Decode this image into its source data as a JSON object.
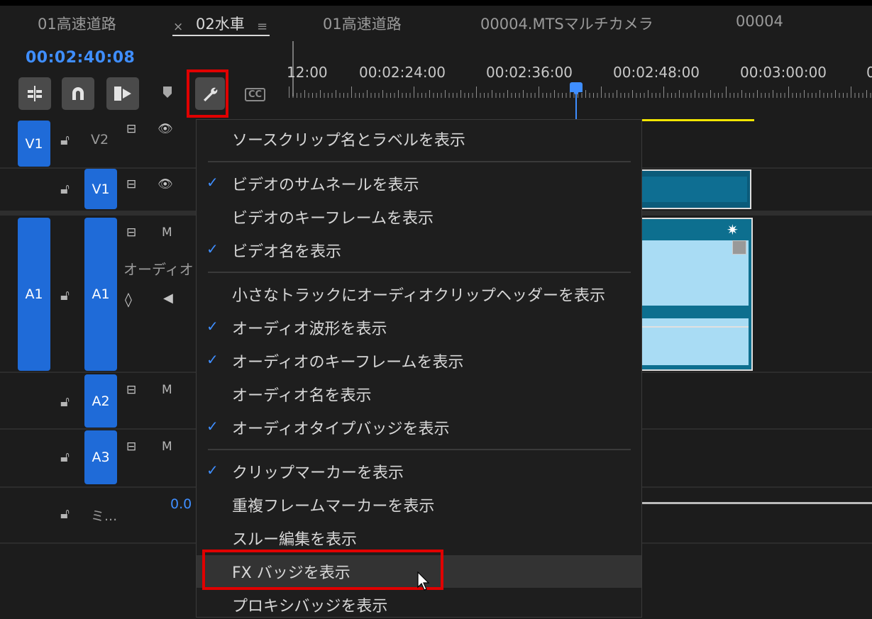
{
  "tabs": [
    {
      "label": "01高速道路",
      "active": false
    },
    {
      "label": "02水車",
      "active": true
    },
    {
      "label": "01高速道路",
      "active": false
    },
    {
      "label": "00004.MTSマルチカメラ",
      "active": false
    },
    {
      "label": "00004",
      "active": false
    }
  ],
  "tab_close": "×",
  "tab_menu": "≡",
  "timecode": "00:02:40:08",
  "ruler_labels": [
    "12:00",
    "00:02:24:00",
    "00:02:36:00",
    "00:02:48:00",
    "00:03:00:00",
    "0"
  ],
  "toolbar": {
    "cc_label": "CC"
  },
  "tracks": {
    "v2_target": "V1",
    "v2_label": "V2",
    "v1_label": "V1",
    "a1_target": "A1",
    "a1_label": "A1",
    "a1_mute": "M",
    "a1_name": "オーディオ",
    "a2_label": "A2",
    "a2_mute": "M",
    "a3_label": "A3",
    "a3_mute": "M",
    "mix_label": "ミ...",
    "mix_value": "0.0"
  },
  "menu": {
    "items": [
      {
        "label": "ソースクリップ名とラベルを表示",
        "checked": false
      },
      {
        "label": "ビデオのサムネールを表示",
        "checked": true
      },
      {
        "label": "ビデオのキーフレームを表示",
        "checked": false
      },
      {
        "label": "ビデオ名を表示",
        "checked": true
      },
      {
        "label": "小さなトラックにオーディオクリップヘッダーを表示",
        "checked": false
      },
      {
        "label": "オーディオ波形を表示",
        "checked": true
      },
      {
        "label": "オーディオのキーフレームを表示",
        "checked": true
      },
      {
        "label": "オーディオ名を表示",
        "checked": false
      },
      {
        "label": "オーディオタイプバッジを表示",
        "checked": true
      },
      {
        "label": "クリップマーカーを表示",
        "checked": true
      },
      {
        "label": "重複フレームマーカーを表示",
        "checked": false
      },
      {
        "label": "スルー編集を表示",
        "checked": false
      },
      {
        "label": "FX バッジを表示",
        "checked": false,
        "hover": true
      },
      {
        "label": "プロキシバッジを表示",
        "checked": false
      }
    ],
    "check_glyph": "✓"
  },
  "colors": {
    "accent_blue": "#3f8eff",
    "track_blue": "#1f6bd8",
    "highlight_red": "#e00000",
    "clip_teal": "#0d6f8f"
  }
}
